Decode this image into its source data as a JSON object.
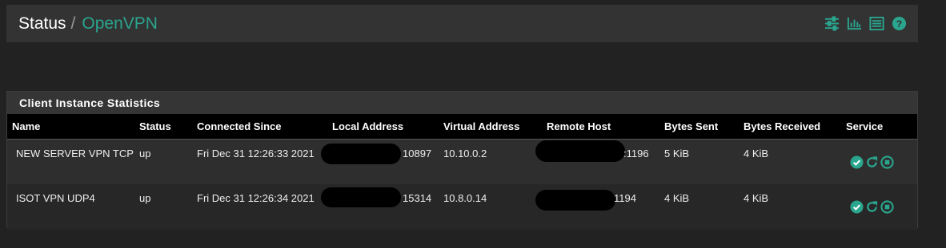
{
  "breadcrumb": {
    "section": "Status",
    "separator": "/",
    "current": "OpenVPN"
  },
  "header_icons": [
    "settings-sliders-icon",
    "bar-chart-icon",
    "list-icon",
    "help-icon"
  ],
  "accent_color": "#2aa58e",
  "panel": {
    "title": "Client Instance Statistics",
    "columns": [
      "Name",
      "Status",
      "Connected Since",
      "Local Address",
      "Virtual Address",
      "Remote Host",
      "Bytes Sent",
      "Bytes Received",
      "Service"
    ],
    "rows": [
      {
        "name": "NEW SERVER VPN TCP",
        "status": "up",
        "connected_since": "Fri Dec 31 12:26:33 2021",
        "local_address": "10897",
        "virtual_address": "10.10.0.2",
        "remote_host": ":1196",
        "bytes_sent": "5 KiB",
        "bytes_received": "4 KiB"
      },
      {
        "name": "ISOT VPN UDP4",
        "status": "up",
        "connected_since": "Fri Dec 31 12:26:34 2021",
        "local_address": "15314",
        "virtual_address": "10.8.0.14",
        "remote_host": "1194",
        "bytes_sent": "4 KiB",
        "bytes_received": "4 KiB"
      }
    ]
  }
}
